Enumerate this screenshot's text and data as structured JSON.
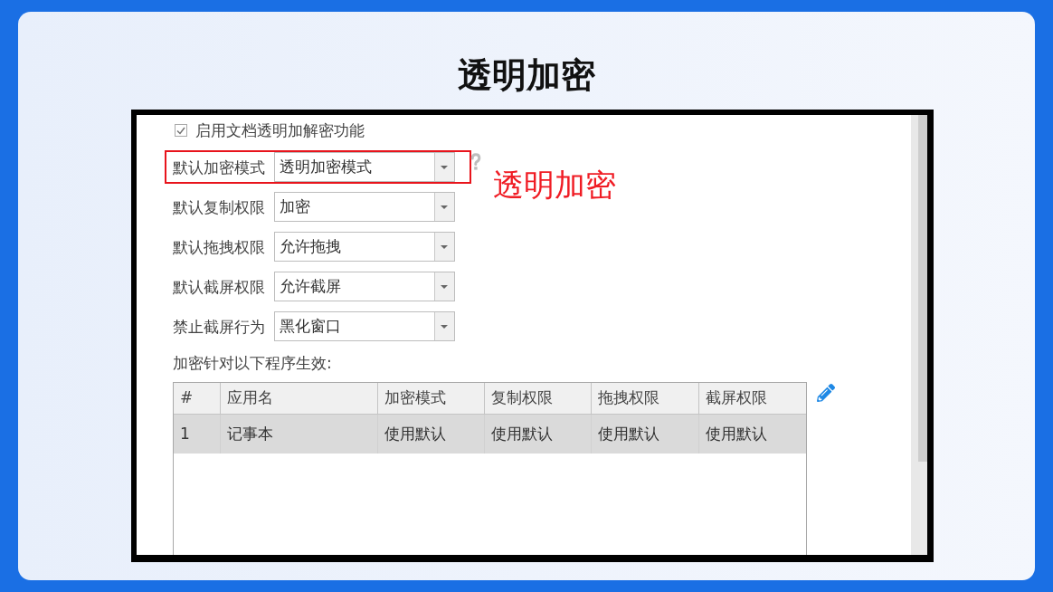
{
  "title": "透明加密",
  "settings_panel": {
    "enable_option": {
      "label": "启用文档透明加解密功能",
      "checked": true
    },
    "fields": [
      {
        "label": "默认加密模式",
        "value": "透明加密模式",
        "highlighted": true,
        "help": true
      },
      {
        "label": "默认复制权限",
        "value": "加密",
        "highlighted": false,
        "help": false
      },
      {
        "label": "默认拖拽权限",
        "value": "允许拖拽",
        "highlighted": false,
        "help": false
      },
      {
        "label": "默认截屏权限",
        "value": "允许截屏",
        "highlighted": false,
        "help": false
      },
      {
        "label": "禁止截屏行为",
        "value": "黑化窗口",
        "highlighted": false,
        "help": false
      }
    ],
    "annotation": "透明加密",
    "table_caption": "加密针对以下程序生效:",
    "table": {
      "columns": [
        "#",
        "应用名",
        "加密模式",
        "复制权限",
        "拖拽权限",
        "截屏权限"
      ],
      "rows": [
        {
          "cells": [
            "1",
            "记事本",
            "使用默认",
            "使用默认",
            "使用默认",
            "使用默认"
          ],
          "selected": true
        }
      ]
    }
  }
}
